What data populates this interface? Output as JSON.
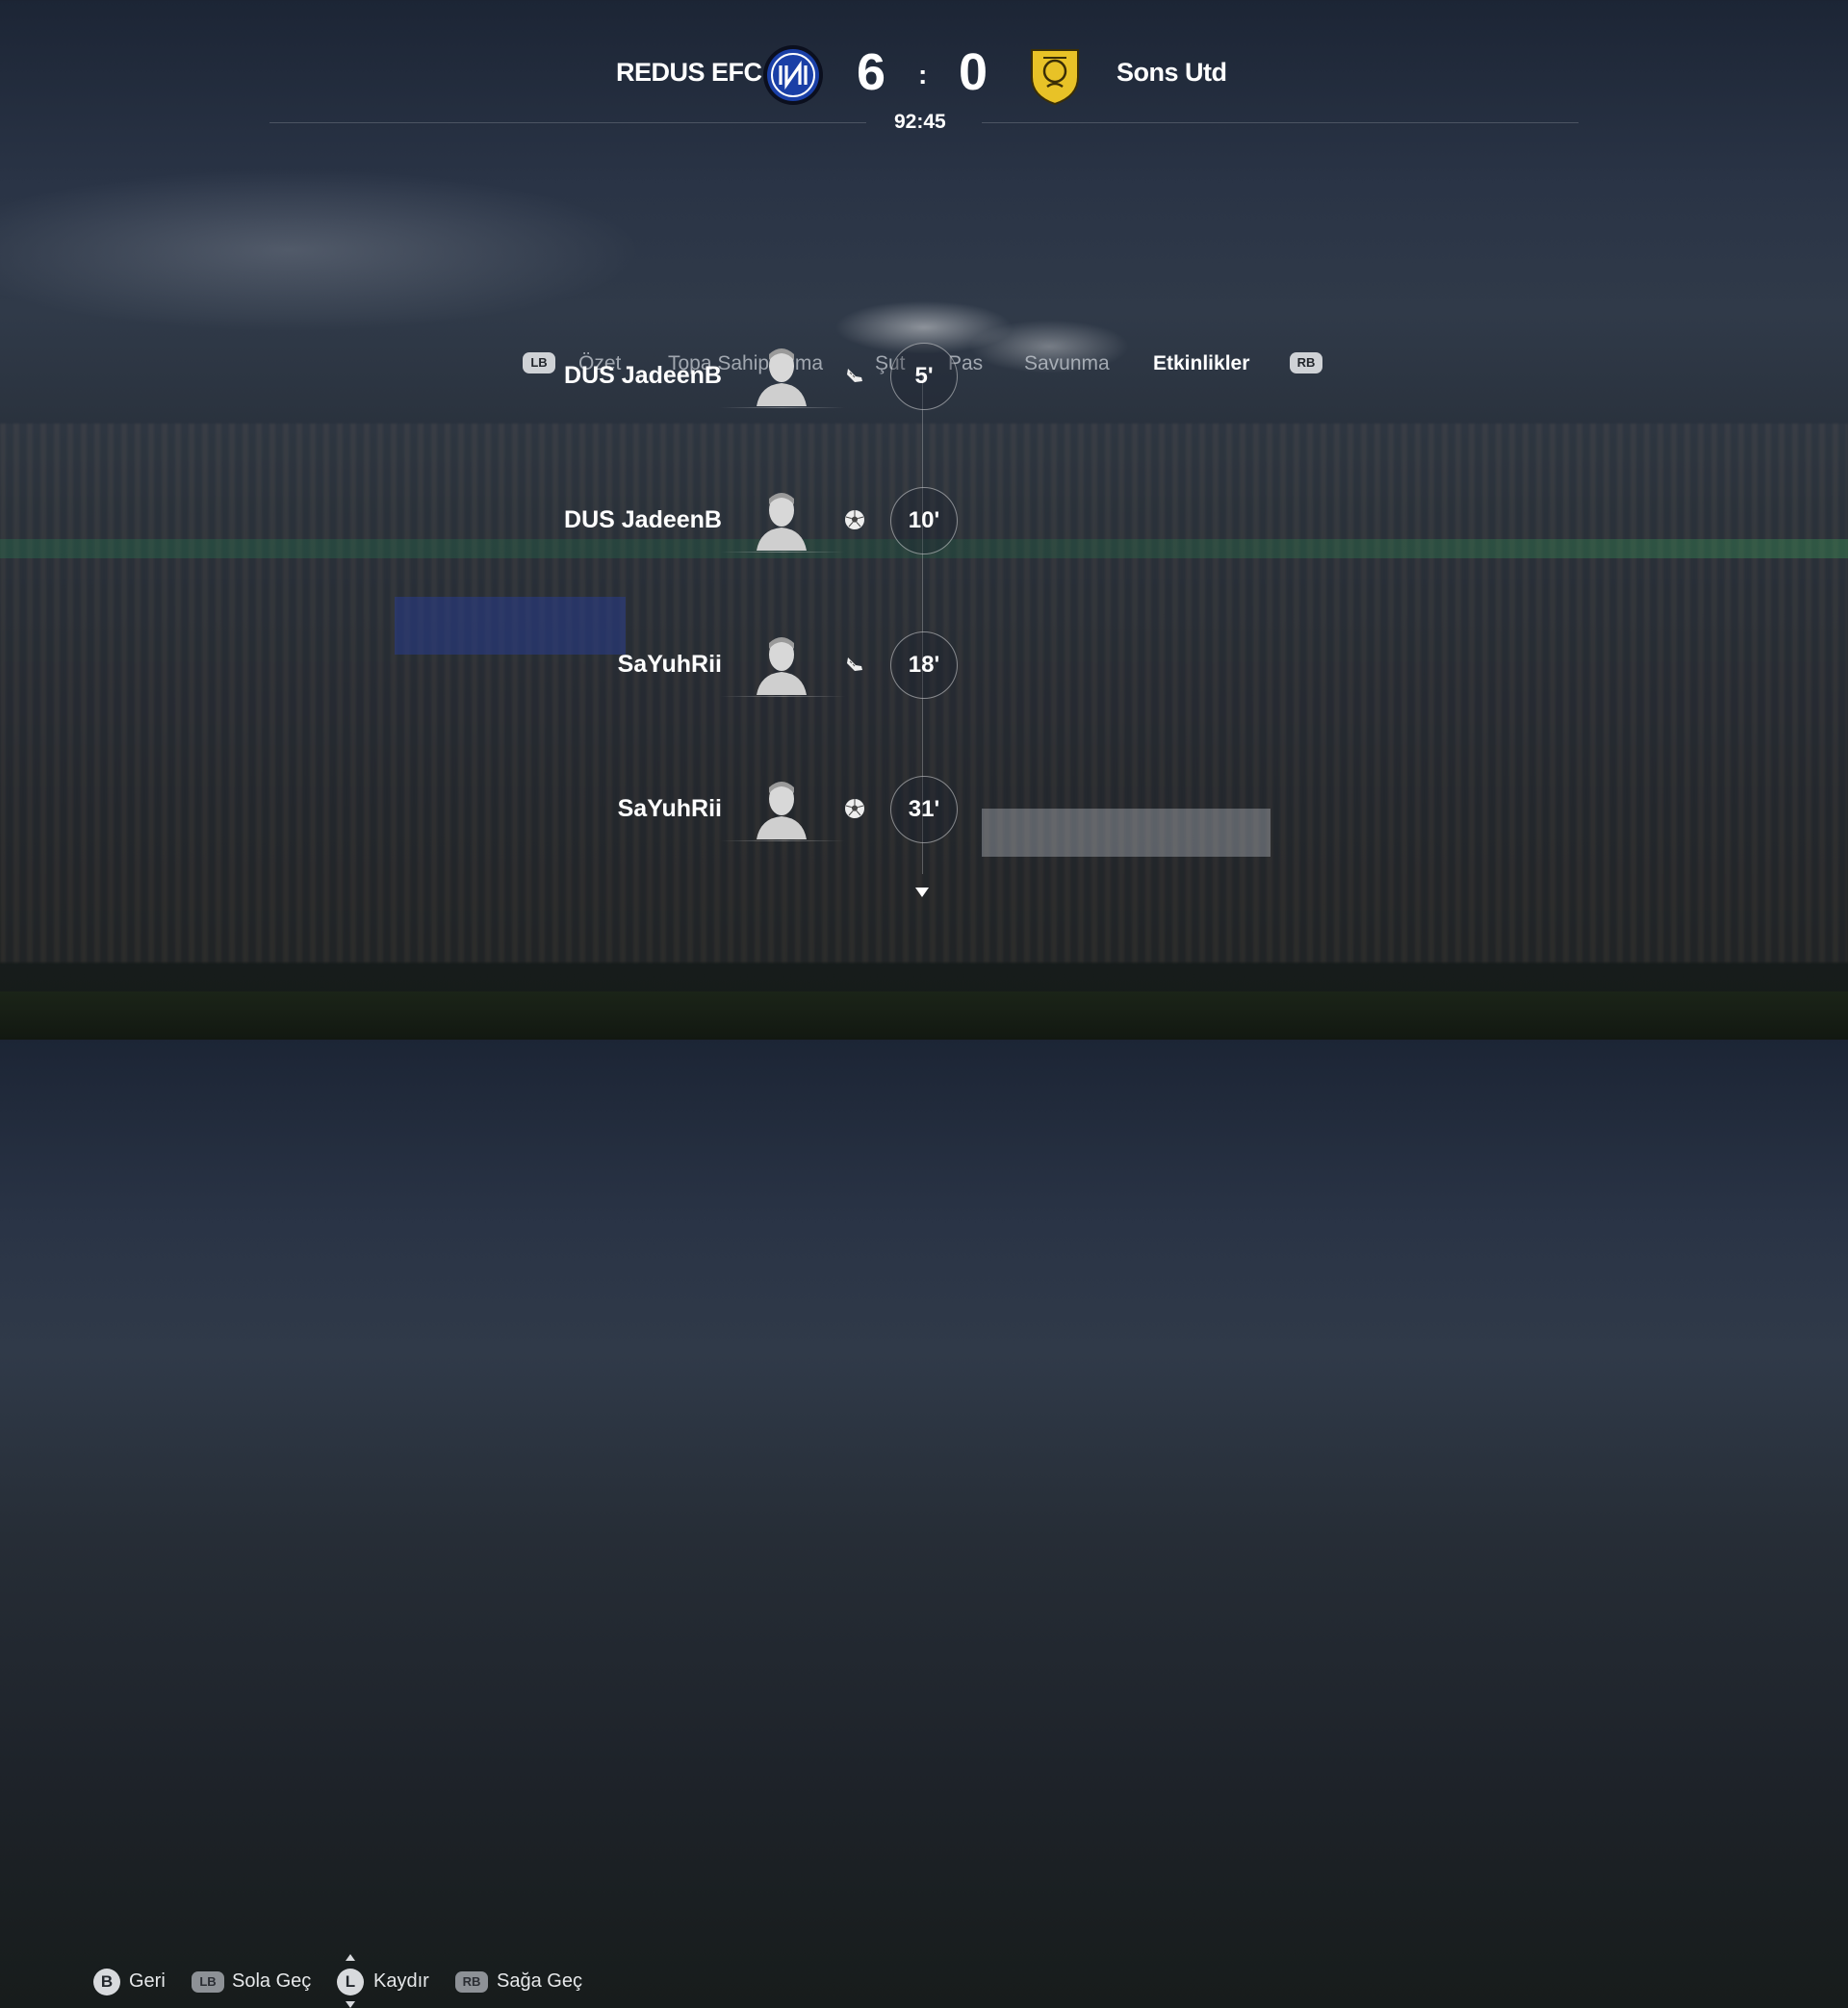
{
  "match": {
    "home_team": "REDUS EFC",
    "away_team": "Sons Utd",
    "home_score": "6",
    "away_score": "0",
    "separator": ":",
    "clock": "92:45"
  },
  "tabs": {
    "left_bumper": "LB",
    "right_bumper": "RB",
    "items": [
      "Özet",
      "Topa Sahip Olma",
      "Şut",
      "Pas",
      "Savunma",
      "Etkinlikler"
    ],
    "active": "Etkinlikler"
  },
  "events": [
    {
      "player": "DUS JadeenB",
      "icon": "assist-boot-icon",
      "minute": "5'"
    },
    {
      "player": "DUS JadeenB",
      "icon": "goal-ball-icon",
      "minute": "10'"
    },
    {
      "player": "SaYuhRii",
      "icon": "assist-boot-icon",
      "minute": "18'"
    },
    {
      "player": "SaYuhRii",
      "icon": "goal-ball-icon",
      "minute": "31'"
    }
  ],
  "footer": {
    "back": {
      "button": "B",
      "label": "Geri"
    },
    "left": {
      "button": "LB",
      "label": "Sola Geç"
    },
    "scroll": {
      "button": "L",
      "label": "Kaydır"
    },
    "right": {
      "button": "RB",
      "label": "Sağa Geç"
    }
  },
  "colors": {
    "home_crest": "#1a3fa6",
    "away_crest": "#e8c227",
    "active_tab": "#ffffff",
    "inactive_tab": "#c8cdd4"
  }
}
